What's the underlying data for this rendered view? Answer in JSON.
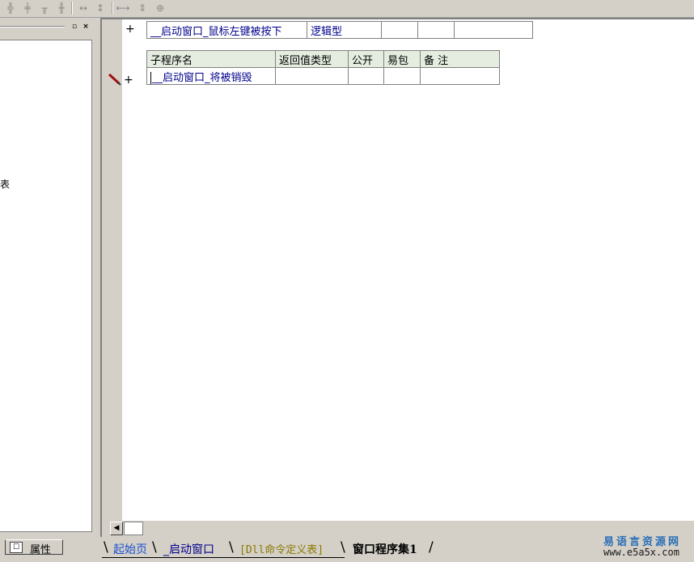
{
  "toolbar": {
    "icons": [
      "align-left-icon",
      "align-center-icon",
      "align-top-icon",
      "align-middle-icon",
      "equal-width-icon",
      "equal-height-icon",
      "equal-size-h-icon",
      "equal-size-v-icon",
      "equal-size-icon"
    ]
  },
  "left_panel": {
    "cut_text": "表",
    "property_tab_label": "属性"
  },
  "editor": {
    "event_row": {
      "plus": "+",
      "name": "__启动窗口_鼠标左键被按下",
      "type": "逻辑型"
    },
    "sub_table": {
      "headers": [
        "子程序名",
        "返回值类型",
        "公开",
        "易包",
        "备 注"
      ],
      "row": {
        "plus": "+",
        "name": "__启动窗口_将被销毁"
      }
    }
  },
  "tabs": [
    "起始页",
    "_启动窗口",
    "[Dll命令定义表]",
    "窗口程序集1"
  ],
  "watermark": {
    "cn": "易语言资源网",
    "url": "www.e5a5x.com"
  }
}
